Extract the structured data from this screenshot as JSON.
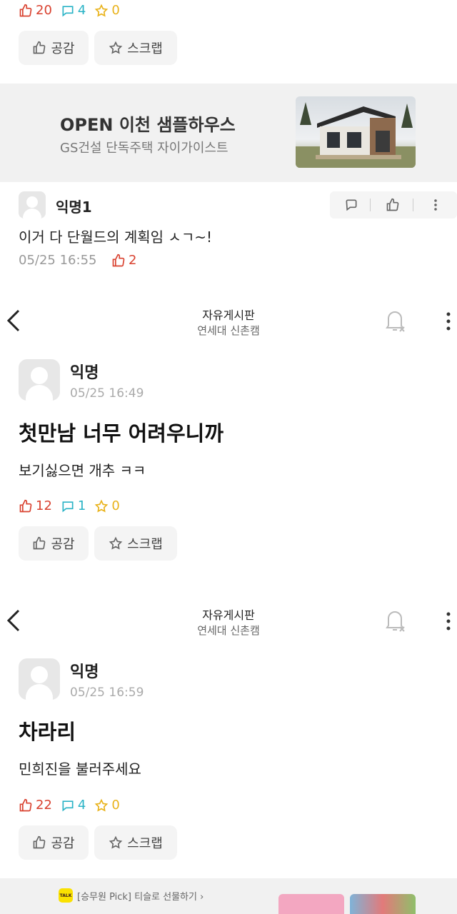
{
  "colors": {
    "like": "#d9412f",
    "comment": "#2ab3c6",
    "scrap": "#e9b21a",
    "bg_gray": "#f1f1f1"
  },
  "header": {
    "title": "자유게시판",
    "subtitle": "연세대 신촌캠"
  },
  "top_post": {
    "likes": "20",
    "comments": "4",
    "scraps": "0",
    "like_button": "공감",
    "scrap_button": "스크랩"
  },
  "ad": {
    "title": "OPEN 이천 샘플하우스",
    "subtitle": "GS건설 단독주택 자이가이스트"
  },
  "comment": {
    "author": "익명1",
    "text": "이거 다 단월드의 계획임 ㅅㄱ~!",
    "time": "05/25 16:55",
    "likes": "2"
  },
  "post1": {
    "author": "익명",
    "time": "05/25 16:49",
    "title": "첫만남 너무 어려우니까",
    "body": "보기싫으면 개추 ㅋㅋ",
    "likes": "12",
    "comments": "1",
    "scraps": "0",
    "like_button": "공감",
    "scrap_button": "스크랩"
  },
  "post2": {
    "author": "익명",
    "time": "05/25 16:59",
    "title": "차라리",
    "body": "민희진을 불러주세요",
    "likes": "22",
    "comments": "4",
    "scraps": "0",
    "like_button": "공감",
    "scrap_button": "스크랩"
  },
  "bottom_ad": {
    "badge": "TALK",
    "text": "[승무원 Pick] 티슬로 선물하기 ›"
  }
}
